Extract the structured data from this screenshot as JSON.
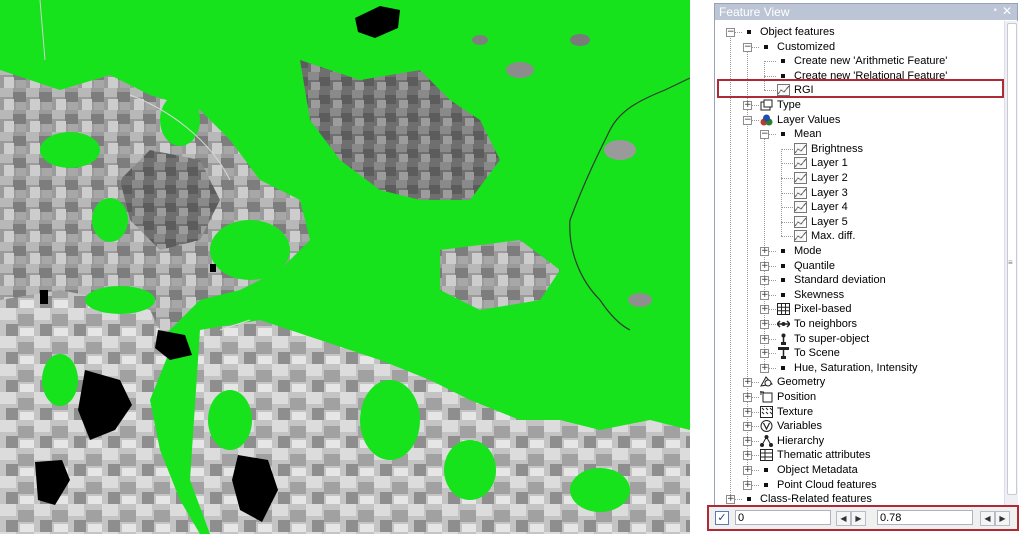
{
  "panel": {
    "title": "Feature View",
    "pin_glyph": "▪",
    "close_glyph": "✕",
    "grip_glyph": "≡"
  },
  "glyphs": {
    "collapse": "−",
    "expand": "+"
  },
  "tree": [
    {
      "label": "Object features",
      "level": 0,
      "expander": "collapse",
      "icon": "bullet"
    },
    {
      "label": "Customized",
      "level": 1,
      "expander": "collapse",
      "icon": "bullet"
    },
    {
      "label": "Create new 'Arithmetic Feature'",
      "level": 2,
      "expander": "none",
      "icon": "bullet"
    },
    {
      "label": "Create new 'Relational Feature'",
      "level": 2,
      "expander": "none",
      "icon": "bullet"
    },
    {
      "label": "RGI",
      "level": 2,
      "expander": "none",
      "icon": "feature-graph",
      "highlighted": true
    },
    {
      "label": "Type",
      "level": 1,
      "expander": "expand",
      "icon": "type"
    },
    {
      "label": "Layer Values",
      "level": 1,
      "expander": "collapse",
      "icon": "layer-values"
    },
    {
      "label": "Mean",
      "level": 2,
      "expander": "collapse",
      "icon": "bullet"
    },
    {
      "label": "Brightness",
      "level": 3,
      "expander": "none",
      "icon": "feature-graph"
    },
    {
      "label": "Layer 1",
      "level": 3,
      "expander": "none",
      "icon": "feature-graph"
    },
    {
      "label": "Layer 2",
      "level": 3,
      "expander": "none",
      "icon": "feature-graph"
    },
    {
      "label": "Layer 3",
      "level": 3,
      "expander": "none",
      "icon": "feature-graph"
    },
    {
      "label": "Layer 4",
      "level": 3,
      "expander": "none",
      "icon": "feature-graph"
    },
    {
      "label": "Layer 5",
      "level": 3,
      "expander": "none",
      "icon": "feature-graph"
    },
    {
      "label": "Max. diff.",
      "level": 3,
      "expander": "none",
      "icon": "feature-graph"
    },
    {
      "label": "Mode",
      "level": 2,
      "expander": "expand",
      "icon": "bullet"
    },
    {
      "label": "Quantile",
      "level": 2,
      "expander": "expand",
      "icon": "bullet"
    },
    {
      "label": "Standard deviation",
      "level": 2,
      "expander": "expand",
      "icon": "bullet"
    },
    {
      "label": "Skewness",
      "level": 2,
      "expander": "expand",
      "icon": "bullet"
    },
    {
      "label": "Pixel-based",
      "level": 2,
      "expander": "expand",
      "icon": "pixel-grid"
    },
    {
      "label": "To neighbors",
      "level": 2,
      "expander": "expand",
      "icon": "neighbors"
    },
    {
      "label": "To super-object",
      "level": 2,
      "expander": "expand",
      "icon": "super-object"
    },
    {
      "label": "To Scene",
      "level": 2,
      "expander": "expand",
      "icon": "scene"
    },
    {
      "label": "Hue, Saturation, Intensity",
      "level": 2,
      "expander": "expand",
      "icon": "bullet"
    },
    {
      "label": "Geometry",
      "level": 1,
      "expander": "expand",
      "icon": "geometry"
    },
    {
      "label": "Position",
      "level": 1,
      "expander": "expand",
      "icon": "position"
    },
    {
      "label": "Texture",
      "level": 1,
      "expander": "expand",
      "icon": "texture"
    },
    {
      "label": "Variables",
      "level": 1,
      "expander": "expand",
      "icon": "variables"
    },
    {
      "label": "Hierarchy",
      "level": 1,
      "expander": "expand",
      "icon": "hierarchy"
    },
    {
      "label": "Thematic attributes",
      "level": 1,
      "expander": "expand",
      "icon": "thematic"
    },
    {
      "label": "Object Metadata",
      "level": 1,
      "expander": "expand",
      "icon": "bullet"
    },
    {
      "label": "Point Cloud features",
      "level": 1,
      "expander": "expand",
      "icon": "bullet"
    },
    {
      "label": "Class-Related features",
      "level": 0,
      "expander": "expand",
      "icon": "bullet"
    }
  ],
  "range": {
    "enabled": true,
    "check_glyph": "✓",
    "min_value": "0",
    "max_value": "0.78",
    "left_arrow": "◀",
    "right_arrow": "▶"
  },
  "colors": {
    "highlight": "#b02a33",
    "map_green": "#16e31c",
    "titlebar": "#bcc5d6"
  }
}
